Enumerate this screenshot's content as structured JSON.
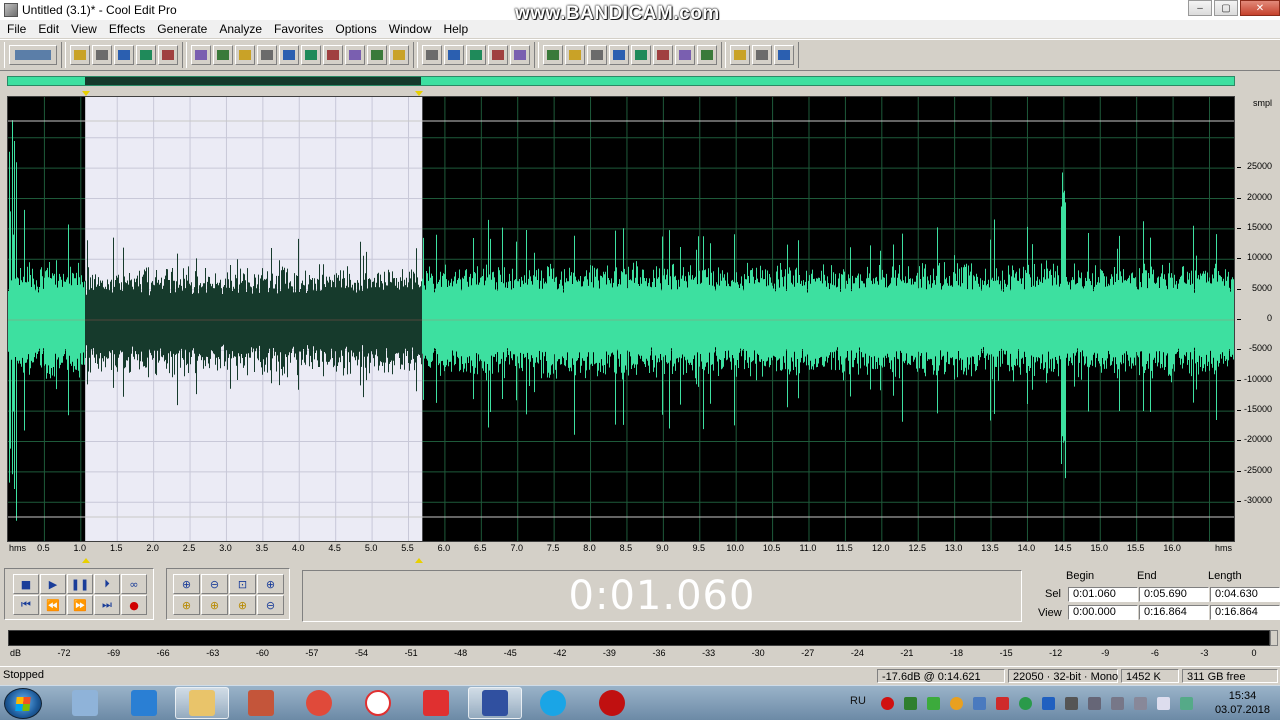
{
  "window": {
    "title": "Untitled (3.1)* - Cool Edit Pro",
    "watermark": "www.BANDICAM.com",
    "buttons": [
      "–",
      "▢",
      "✕"
    ]
  },
  "menu": [
    "File",
    "Edit",
    "View",
    "Effects",
    "Generate",
    "Analyze",
    "Favorites",
    "Options",
    "Window",
    "Help"
  ],
  "toolbar_icons": [
    [
      "multitrack-toggle-icon"
    ],
    [
      "new-file-icon",
      "open-file-icon",
      "close-file-icon",
      "save-file-icon",
      "save-selection-icon"
    ],
    [
      "undo-icon",
      "redo-icon",
      "repeat-last-icon",
      "copy-icon",
      "copy-new-icon",
      "cut-icon",
      "paste-icon",
      "paste-new-icon",
      "mix-paste-icon",
      "trim-icon"
    ],
    [
      "spectral-view-icon",
      "show-cue-icon",
      "settings-icon",
      "settings2-icon",
      "settings3-icon"
    ],
    [
      "cue-list-icon",
      "play-list-icon",
      "info-icon",
      "edit-play-icon",
      "scripts-icon",
      "cd-player-icon",
      "record-icon",
      "levels-icon"
    ],
    [
      "favorites-icon",
      "tools-icon",
      "help-icon"
    ]
  ],
  "waveform": {
    "colors": {
      "background": "#000000",
      "wave": "#3de0a0",
      "selection_bg": "#ebebf5",
      "selection_wave": "#163a2c",
      "grid": "#1e5a3a",
      "limit_line": "#c8c8c8"
    },
    "selection_start_sec": 1.06,
    "selection_end_sec": 5.69,
    "view_start_sec": 0.0,
    "view_end_sec": 16.864
  },
  "y_axis": {
    "unit": "smpl",
    "ticks": [
      "25000",
      "20000",
      "15000",
      "10000",
      "5000",
      "0",
      "-5000",
      "-10000",
      "-15000",
      "-20000",
      "-25000",
      "-30000"
    ]
  },
  "x_axis": {
    "unit_left": "hms",
    "unit_right": "hms",
    "ticks": [
      "0.5",
      "1.0",
      "1.5",
      "2.0",
      "2.5",
      "3.0",
      "3.5",
      "4.0",
      "4.5",
      "5.0",
      "5.5",
      "6.0",
      "6.5",
      "7.0",
      "7.5",
      "8.0",
      "8.5",
      "9.0",
      "9.5",
      "10.0",
      "10.5",
      "11.0",
      "11.5",
      "12.0",
      "12.5",
      "13.0",
      "13.5",
      "14.0",
      "14.5",
      "15.0",
      "15.5",
      "16.0"
    ]
  },
  "transport": [
    "■",
    "▶",
    "❚❚",
    "⏵",
    "∞",
    "⏮",
    "⏪",
    "⏩",
    "⏭",
    "●"
  ],
  "zoom": [
    "⊕",
    "⊖",
    "⊡",
    "⊕",
    "⊕",
    "⊕",
    "⊕",
    "⊖"
  ],
  "time_display": "0:01.060",
  "selection": {
    "headers": [
      "Begin",
      "End",
      "Length"
    ],
    "sel_label": "Sel",
    "view_label": "View",
    "sel": [
      "0:01.060",
      "0:05.690",
      "0:04.630"
    ],
    "view": [
      "0:00.000",
      "0:16.864",
      "0:16.864"
    ]
  },
  "meter_scale": [
    "dB",
    "-72",
    "-69",
    "-66",
    "-63",
    "-60",
    "-57",
    "-54",
    "-51",
    "-48",
    "-45",
    "-42",
    "-39",
    "-36",
    "-33",
    "-30",
    "-27",
    "-24",
    "-21",
    "-18",
    "-15",
    "-12",
    "-9",
    "-6",
    "-3",
    "0"
  ],
  "status": {
    "state": "Stopped",
    "cursor": "-17.6dB @  0:14.621",
    "format": "22050 · 32-bit · Mono",
    "size": "1452 K",
    "free": "311 GB free"
  },
  "taskbar": {
    "lang": "RU",
    "time": "15:34",
    "date": "03.07.2018",
    "apps": [
      "calculator",
      "internet-explorer",
      "file-explorer",
      "media-app",
      "chrome",
      "yandex-browser",
      "yandex-disk",
      "cool-edit-pro",
      "skype",
      "bandicam"
    ]
  }
}
